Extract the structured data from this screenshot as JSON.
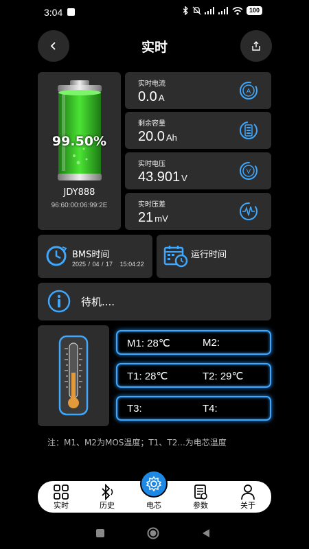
{
  "status_bar": {
    "time": "3:04",
    "battery": "100"
  },
  "header": {
    "title": "实时"
  },
  "battery": {
    "percent": "99.50%",
    "device_name": "JDY888",
    "device_id": "96:60:00:06:99:2E"
  },
  "metrics": [
    {
      "label": "实时电流",
      "value": "0.0",
      "unit": "A",
      "icon": "current-icon"
    },
    {
      "label": "剩余容量",
      "value": "20.0",
      "unit": "Ah",
      "icon": "capacity-icon"
    },
    {
      "label": "实时电压",
      "value": "43.901",
      "unit": "V",
      "icon": "voltage-icon"
    },
    {
      "label": "实时压差",
      "value": "21",
      "unit": "mV",
      "icon": "pressure-diff-icon"
    }
  ],
  "bms": {
    "title": "BMS时间",
    "date": "2025 / 04 / 17",
    "time": "15:04:22"
  },
  "run_time": {
    "title": "运行时间"
  },
  "status": {
    "text": "待机...."
  },
  "temperatures": [
    {
      "left": "M1: 28℃",
      "right": "M2:"
    },
    {
      "left": "T1: 28℃",
      "right": "T2: 29℃"
    },
    {
      "left": "T3:",
      "right": "T4:"
    }
  ],
  "note": "注：M1、M2为MOS温度；T1、T2...为电芯温度",
  "nav": {
    "items": [
      {
        "label": "实时",
        "icon": "grid-icon"
      },
      {
        "label": "历史",
        "icon": "bluetooth-icon"
      },
      {
        "label": "电芯",
        "icon": "gear-icon"
      },
      {
        "label": "参数",
        "icon": "document-icon"
      },
      {
        "label": "关于",
        "icon": "person-icon"
      }
    ]
  },
  "colors": {
    "accent": "#1e88e5",
    "card": "#2d2d2d",
    "battery_green": "#3fd12a",
    "thermo_orange": "#e39a3a"
  }
}
